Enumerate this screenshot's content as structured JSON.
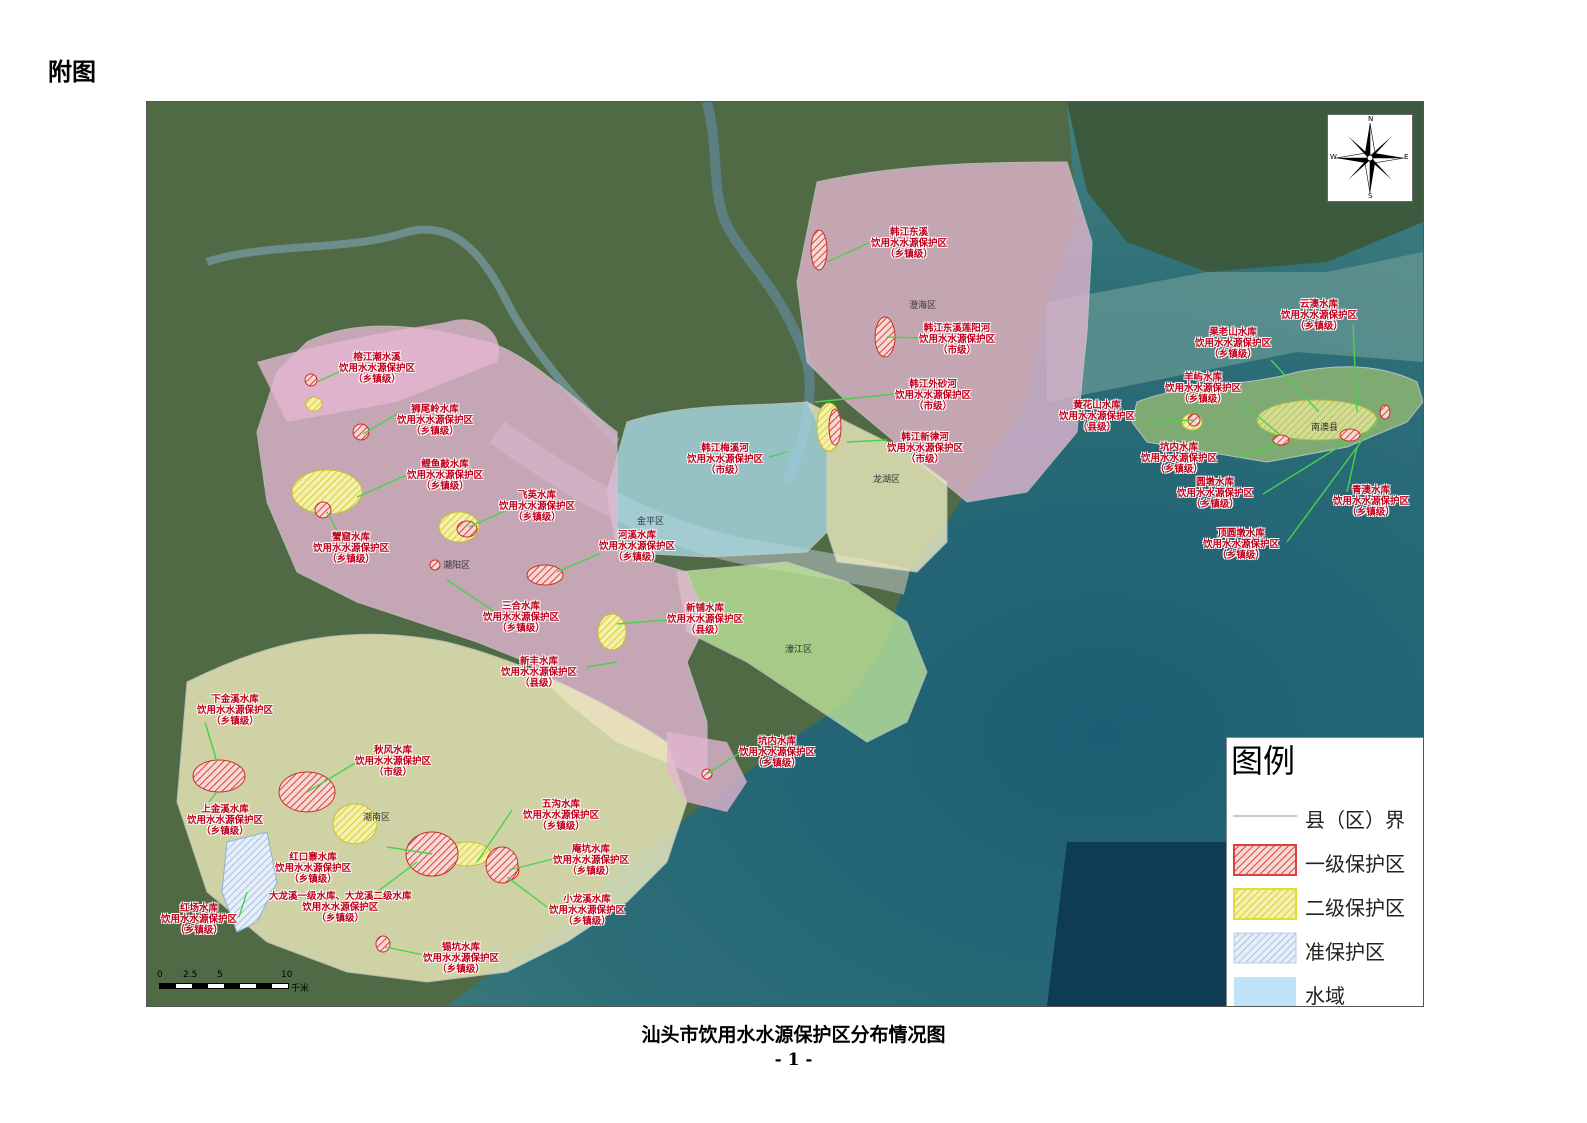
{
  "figure_label": "附图",
  "caption": "汕头市饮用水水源保护区分布情况图",
  "page_number": "- 1 -",
  "compass": {
    "n": "N",
    "s": "S",
    "e": "E",
    "w": "W"
  },
  "legend": {
    "title": "图例",
    "items": [
      {
        "label": "县（区）界",
        "kind": "line",
        "color": "#b8b8b8"
      },
      {
        "label": "一级保护区",
        "kind": "hatch",
        "color": "#e0504a"
      },
      {
        "label": "二级保护区",
        "kind": "hatch",
        "color": "#e8e23a"
      },
      {
        "label": "准保护区",
        "kind": "hatch",
        "color": "#a6c4e4"
      },
      {
        "label": "水域",
        "kind": "fill",
        "color": "#bfe3f7"
      }
    ]
  },
  "scale": {
    "ticks": [
      "0",
      "2.5",
      "5",
      "10"
    ],
    "unit": "千米"
  },
  "districts": [
    "澄海区",
    "金平区",
    "龙湖区",
    "濠江区",
    "潮阳区",
    "潮南区",
    "南澳县"
  ],
  "callouts": [
    {
      "lines": [
        "韩江东溪",
        "饮用水水源保护区",
        "（乡镇级）"
      ]
    },
    {
      "lines": [
        "韩江东溪莲阳河",
        "饮用水水源保护区",
        "（市级）"
      ]
    },
    {
      "lines": [
        "韩江外砂河",
        "饮用水水源保护区",
        "（市级）"
      ]
    },
    {
      "lines": [
        "韩江新律河",
        "饮用水水源保护区",
        "（市级）"
      ]
    },
    {
      "lines": [
        "韩江梅溪河",
        "饮用水水源保护区",
        "（市级）"
      ]
    },
    {
      "lines": [
        "榕江潮水溪",
        "饮用水水源保护区",
        "（乡镇级）"
      ]
    },
    {
      "lines": [
        "狮尾岭水库",
        "饮用水水源保护区",
        "（乡镇级）"
      ]
    },
    {
      "lines": [
        "鲤鱼敲水库",
        "饮用水水源保护区",
        "（乡镇级）"
      ]
    },
    {
      "lines": [
        "飞英水库",
        "饮用水水源保护区",
        "（乡镇级）"
      ]
    },
    {
      "lines": [
        "蟹窟水库",
        "饮用水水源保护区",
        "（乡镇级）"
      ]
    },
    {
      "lines": [
        "河溪水库",
        "饮用水水源保护区",
        "（乡镇级）"
      ]
    },
    {
      "lines": [
        "三合水库",
        "饮用水水源保护区",
        "（乡镇级）"
      ]
    },
    {
      "lines": [
        "新铺水库",
        "饮用水水源保护区",
        "（县级）"
      ]
    },
    {
      "lines": [
        "新丰水库",
        "饮用水水源保护区",
        "（县级）"
      ]
    },
    {
      "lines": [
        "下金溪水库",
        "饮用水水源保护区",
        "（乡镇级）"
      ]
    },
    {
      "lines": [
        "秋风水库",
        "饮用水水源保护区",
        "（市级）"
      ]
    },
    {
      "lines": [
        "上金溪水库",
        "饮用水水源保护区",
        "（乡镇级）"
      ]
    },
    {
      "lines": [
        "五沟水库",
        "饮用水水源保护区",
        "（乡镇级）"
      ]
    },
    {
      "lines": [
        "红口寨水库",
        "饮用水水源保护区",
        "（乡镇级）"
      ]
    },
    {
      "lines": [
        "庵坑水库",
        "饮用水水源保护区",
        "（乡镇级）"
      ]
    },
    {
      "lines": [
        "大龙溪一级水库、大龙溪二级水库",
        "饮用水水源保护区",
        "（乡镇级）"
      ]
    },
    {
      "lines": [
        "红场水库",
        "饮用水水源保护区",
        "（乡镇级）"
      ]
    },
    {
      "lines": [
        "小龙溪水库",
        "饮用水水源保护区",
        "（乡镇级）"
      ]
    },
    {
      "lines": [
        "锡坑水库",
        "饮用水水源保护区",
        "（乡镇级）"
      ]
    },
    {
      "lines": [
        "坑内水库",
        "饮用水水源保护区",
        "（乡镇级）"
      ]
    },
    {
      "lines": [
        "云澳水库",
        "饮用水水源保护区",
        "（乡镇级）"
      ]
    },
    {
      "lines": [
        "果老山水库",
        "饮用水水源保护区",
        "（乡镇级）"
      ]
    },
    {
      "lines": [
        "羊屿水库",
        "饮用水水源保护区",
        "（乡镇级）"
      ]
    },
    {
      "lines": [
        "黄花山水库",
        "饮用水水源保护区",
        "（县级）"
      ]
    },
    {
      "lines": [
        "坑内水库",
        "饮用水水源保护区",
        "（乡镇级）"
      ]
    },
    {
      "lines": [
        "圆墩水库",
        "饮用水水源保护区",
        "（乡镇级）"
      ]
    },
    {
      "lines": [
        "青澳水库",
        "饮用水水源保护区",
        "（乡镇级）"
      ]
    },
    {
      "lines": [
        "顶圆墩水库",
        "饮用水水源保护区",
        "（乡镇级）"
      ]
    }
  ]
}
